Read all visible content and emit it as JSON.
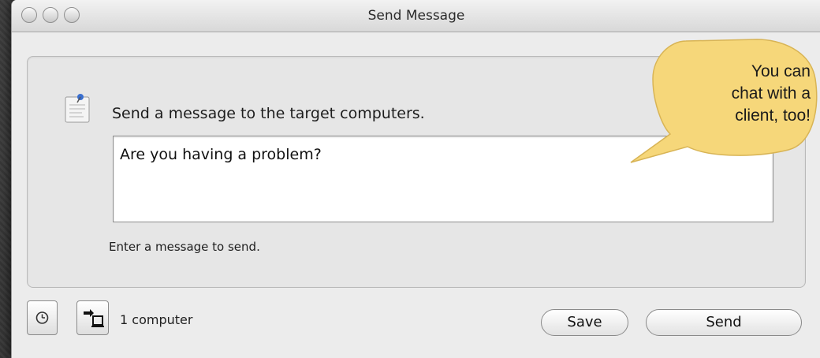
{
  "window": {
    "title": "Send Message"
  },
  "main": {
    "prompt": "Send a message to the target computers.",
    "message_value": "Are you having a problem?",
    "hint": "Enter a message to send."
  },
  "footer": {
    "computer_count": "1 computer",
    "save_label": "Save",
    "send_label": "Send"
  },
  "callout": {
    "line1": "You can",
    "line2": "chat with a",
    "line3": "client, too!"
  },
  "icons": {
    "note": "note-icon",
    "clock": "clock-icon",
    "target_list": "target-list-icon"
  },
  "colors": {
    "callout_fill": "#f6d77a",
    "window_bg": "#ececec",
    "desktop_bg": "#3b3b3b"
  }
}
